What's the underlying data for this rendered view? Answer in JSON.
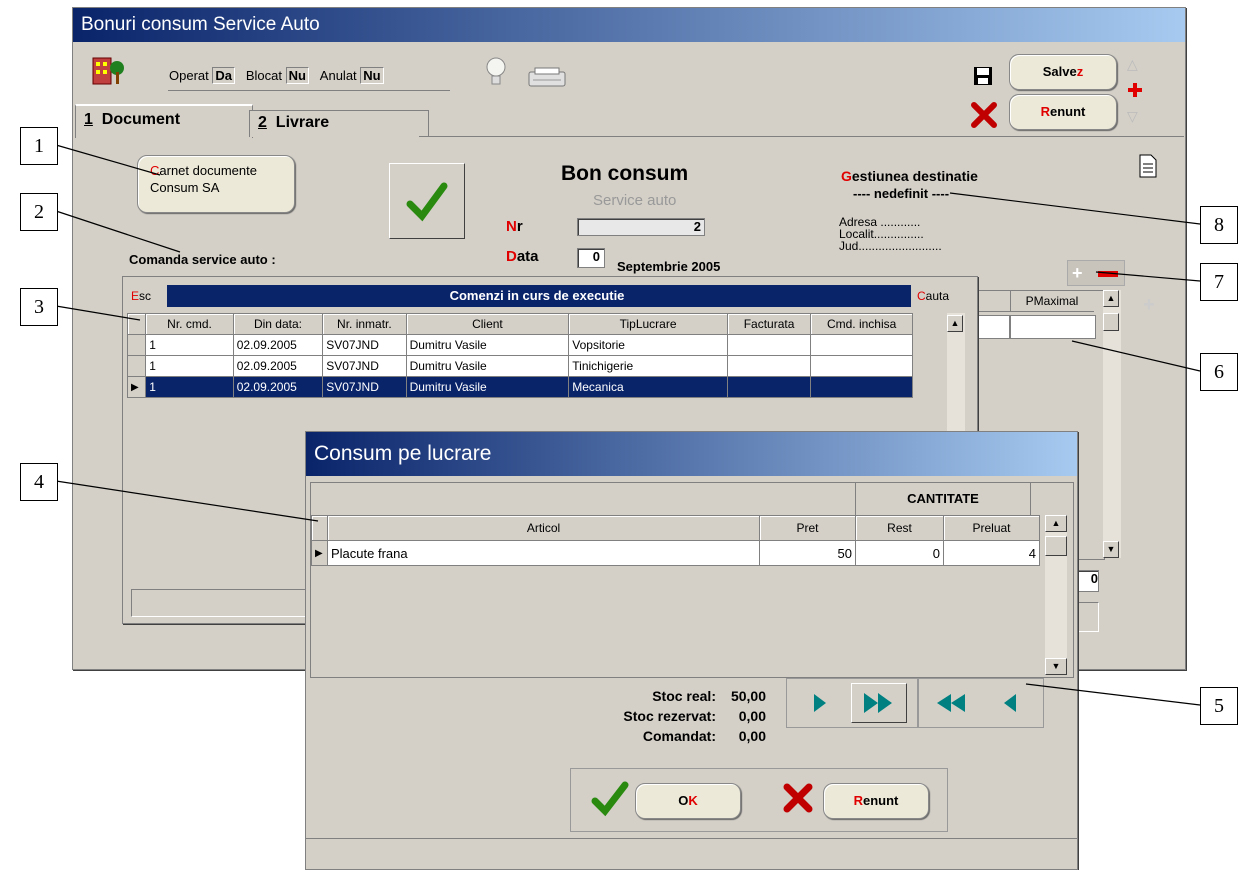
{
  "main": {
    "title": "Bonuri consum Service Auto",
    "operat_label": "Operat",
    "operat_value": "Da",
    "blocat_label": "Blocat",
    "blocat_value": "Nu",
    "anulat_label": "Anulat",
    "anulat_value": "Nu",
    "save_first": "Salve",
    "save_last": "z",
    "cancel_first": "R",
    "cancel_rest": "enunt",
    "tabs": [
      {
        "num": "1",
        "label": "Document"
      },
      {
        "num": "2",
        "label": "Livrare"
      }
    ],
    "carnet_first": "C",
    "carnet_rest": "arnet documente",
    "carnet_line2": "Consum SA",
    "doc_title": "Bon consum",
    "doc_subtitle": "Service auto",
    "nr_first": "N",
    "nr_rest": "r",
    "nr_value": "2",
    "data_first": "D",
    "data_rest": "ata",
    "data_day": "0",
    "data_month": "Septembrie 2005",
    "gest_first": "G",
    "gest_rest": "estiunea destinatie",
    "gest_value": "---- nedefinit ----",
    "adresa": "Adresa ............",
    "localit": "Localit...............",
    "jud": "Jud.........................",
    "comanda_label": "Comanda service auto :",
    "pmaximal": "PMaximal",
    "bottom_val": "0"
  },
  "orders": {
    "esc_first": "E",
    "esc_rest": "sc",
    "title": "Comenzi in curs de executie",
    "cauta_first": "C",
    "cauta_rest": "auta",
    "columns": [
      "Nr. cmd.",
      "Din data:",
      "Nr. inmatr.",
      "Client",
      "TipLucrare",
      "Facturata",
      "Cmd. inchisa"
    ],
    "rows": [
      [
        "1",
        "02.09.2005",
        "SV07JND",
        "Dumitru Vasile",
        "Vopsitorie",
        "",
        ""
      ],
      [
        "1",
        "02.09.2005",
        "SV07JND",
        "Dumitru Vasile",
        "Tinichigerie",
        "",
        ""
      ],
      [
        "1",
        "02.09.2005",
        "SV07JND",
        "Dumitru Vasile",
        "Mecanica",
        "",
        ""
      ]
    ]
  },
  "consum": {
    "title": "Consum pe lucrare",
    "group_header": "CANTITATE",
    "columns": [
      "Articol",
      "Pret",
      "Rest",
      "Preluat"
    ],
    "row": [
      "Placute frana",
      "50",
      "0",
      "4"
    ],
    "stoc_real_label": "Stoc real:",
    "stoc_real": "50,00",
    "stoc_rezervat_label": "Stoc rezervat:",
    "stoc_rezervat": "0,00",
    "comandat_label": "Comandat:",
    "comandat": "0,00",
    "ok_first": "O",
    "ok_rest": "K",
    "renunt_first": "R",
    "renunt_rest": "enunt"
  },
  "callouts": [
    "1",
    "2",
    "3",
    "4",
    "5",
    "6",
    "7",
    "8"
  ],
  "colors": {
    "title_dark": "#0a246a",
    "title_light": "#a6caf0",
    "selection": "#0a246a",
    "accent_red": "#e00000",
    "window": "#d4d0c8"
  }
}
